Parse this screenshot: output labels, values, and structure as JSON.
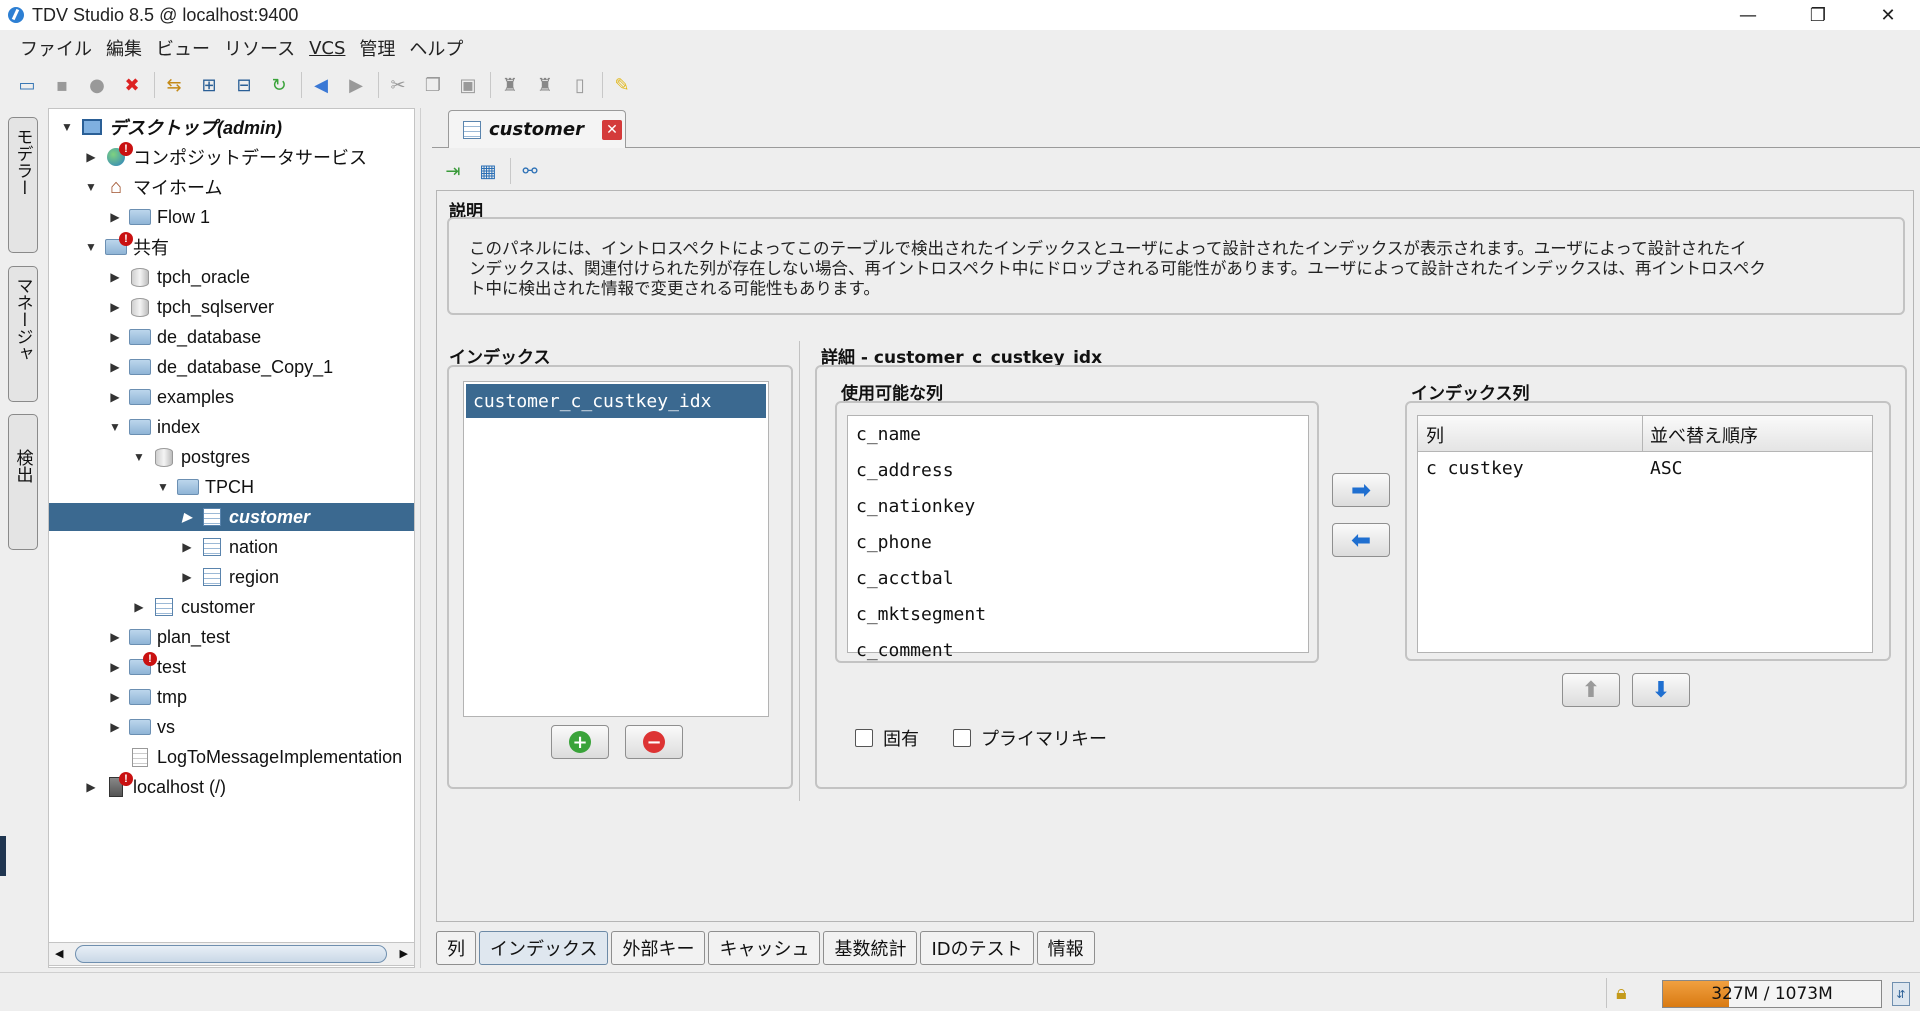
{
  "window": {
    "title": "TDV Studio 8.5 @ localhost:9400"
  },
  "menu": [
    "ファイル",
    "編集",
    "ビュー",
    "リソース",
    "VCS",
    "管理",
    "ヘルプ"
  ],
  "side_tabs": [
    "モデラー",
    "マネージャ",
    "検出"
  ],
  "tree": [
    {
      "label": "デスクトップ(admin)",
      "level": 0,
      "expander": "▼",
      "icon": "desktop-icon",
      "bold": true
    },
    {
      "label": "コンポジットデータサービス",
      "level": 1,
      "expander": "▶",
      "icon": "globe-icon",
      "error": true
    },
    {
      "label": "マイホーム",
      "level": 1,
      "expander": "▼",
      "icon": "home-icon"
    },
    {
      "label": "Flow 1",
      "level": 2,
      "expander": "▶",
      "icon": "folder-icon"
    },
    {
      "label": "共有",
      "level": 1,
      "expander": "▼",
      "icon": "shared-folder-icon",
      "error": true
    },
    {
      "label": "tpch_oracle",
      "level": 2,
      "expander": "▶",
      "icon": "database-icon"
    },
    {
      "label": "tpch_sqlserver",
      "level": 2,
      "expander": "▶",
      "icon": "database-icon"
    },
    {
      "label": "de_database",
      "level": 2,
      "expander": "▶",
      "icon": "folder-icon"
    },
    {
      "label": "de_database_Copy_1",
      "level": 2,
      "expander": "▶",
      "icon": "folder-icon"
    },
    {
      "label": "examples",
      "level": 2,
      "expander": "▶",
      "icon": "folder-icon"
    },
    {
      "label": "index",
      "level": 2,
      "expander": "▼",
      "icon": "folder-icon"
    },
    {
      "label": "postgres",
      "level": 3,
      "expander": "▼",
      "icon": "database-icon"
    },
    {
      "label": "TPCH",
      "level": 4,
      "expander": "▼",
      "icon": "folder-icon"
    },
    {
      "label": "customer",
      "level": 5,
      "expander": "▶",
      "icon": "table-icon",
      "selected": true
    },
    {
      "label": "nation",
      "level": 5,
      "expander": "▶",
      "icon": "table-icon"
    },
    {
      "label": "region",
      "level": 5,
      "expander": "▶",
      "icon": "table-icon"
    },
    {
      "label": "customer",
      "level": 3,
      "expander": "▶",
      "icon": "view-icon"
    },
    {
      "label": "plan_test",
      "level": 2,
      "expander": "▶",
      "icon": "folder-icon"
    },
    {
      "label": "test",
      "level": 2,
      "expander": "▶",
      "icon": "folder-icon",
      "error": true
    },
    {
      "label": "tmp",
      "level": 2,
      "expander": "▶",
      "icon": "folder-icon"
    },
    {
      "label": "vs",
      "level": 2,
      "expander": "▶",
      "icon": "folder-icon"
    },
    {
      "label": "LogToMessageImplementation",
      "level": 2,
      "expander": "",
      "icon": "document-icon"
    },
    {
      "label": "localhost (/)",
      "level": 1,
      "expander": "▶",
      "icon": "server-icon",
      "error": true
    }
  ],
  "editor_tab": {
    "label": "customer"
  },
  "description": {
    "title": "説明",
    "lines": [
      "このパネルには、イントロスペクトによってこのテーブルで検出されたインデックスとユーザによって設計されたインデックスが表示されます。ユーザによって設計されたイ",
      "ンデックスは、関連付けられた列が存在しない場合、再イントロスペクト中にドロップされる可能性があります。ユーザによって設計されたインデックスは、再イントロスペク",
      "ト中に検出された情報で変更される可能性もあります。"
    ]
  },
  "indexes": {
    "title": "インデックス",
    "items": [
      "customer_c_custkey_idx"
    ]
  },
  "detail": {
    "title": "詳細 - customer_c_custkey_idx",
    "available_title": "使用可能な列",
    "available": [
      "c_name",
      "c_address",
      "c_nationkey",
      "c_phone",
      "c_acctbal",
      "c_mktsegment",
      "c_comment"
    ],
    "index_cols_title": "インデックス列",
    "index_cols_headers": [
      "列",
      "並べ替え順序"
    ],
    "index_cols": [
      {
        "col": "c custkey",
        "order": "ASC"
      }
    ],
    "unique_label": "固有",
    "primary_label": "プライマリキー"
  },
  "bottom_tabs": [
    "列",
    "インデックス",
    "外部キー",
    "キャッシュ",
    "基数統計",
    "IDのテスト",
    "情報"
  ],
  "memory": {
    "label": "327M / 1073M",
    "used_fraction": 0.305
  }
}
